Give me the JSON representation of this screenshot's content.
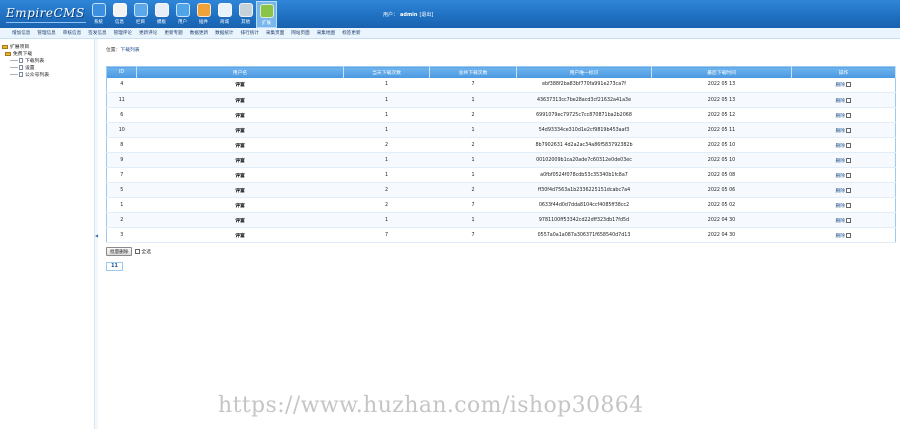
{
  "brand": {
    "logo_text": "EmpireCMS"
  },
  "nav": {
    "items": [
      {
        "label": "系统",
        "icon": "system-icon",
        "color": "#3a8fe0"
      },
      {
        "label": "信息",
        "icon": "info-icon",
        "color": "#f3f3f3"
      },
      {
        "label": "栏目",
        "icon": "column-icon",
        "color": "#5aa7ea"
      },
      {
        "label": "模板",
        "icon": "template-icon",
        "color": "#e8eef5"
      },
      {
        "label": "用户",
        "icon": "user-icon",
        "color": "#4da4e8"
      },
      {
        "label": "插件",
        "icon": "plugin-icon",
        "color": "#f0a23a"
      },
      {
        "label": "商城",
        "icon": "shop-icon",
        "color": "#e8f2fa"
      },
      {
        "label": "其他",
        "icon": "other-icon",
        "color": "#c7d1da"
      },
      {
        "label": "扩展",
        "icon": "extend-icon",
        "color": "#8bc34a",
        "active": true
      }
    ]
  },
  "user": {
    "prefix": "用户：",
    "name": "admin",
    "logout": "[退出]"
  },
  "subnav": {
    "items": [
      "增加信息",
      "管理信息",
      "审核信息",
      "签发信息",
      "管理评论",
      "更新评论",
      "更新专题",
      "数据更新",
      "数据统计",
      "排行统计",
      "采集页面",
      "网站页面",
      "采集地图",
      "标签更新"
    ]
  },
  "tree": {
    "root": "扩展项目",
    "group": "免费下载",
    "children": [
      "下载列表",
      "设置",
      "公众号列表"
    ]
  },
  "breadcrumb": {
    "prefix": "位置：",
    "link": "下载列表"
  },
  "table": {
    "headers": [
      "ID",
      "用户名",
      "当天下载次数",
      "总共下载次数",
      "用户唯一标识",
      "最后下载时间",
      "操作"
    ],
    "rows": [
      {
        "id": "4",
        "username": "评富",
        "today": "1",
        "total": "7",
        "uid": "ebf388f2ba83bf770fa991e273ca7f",
        "last": "2022 05 13",
        "op": "删除"
      },
      {
        "id": "11",
        "username": "评富",
        "today": "1",
        "total": "1",
        "uid": "43637313cc7be28acd3cf21632a41a3e",
        "last": "2022 05 13",
        "op": "删除"
      },
      {
        "id": "6",
        "username": "评富",
        "today": "1",
        "total": "2",
        "uid": "6991079ec79725c7cc870871ba2b2068",
        "last": "2022 05 12",
        "op": "删除"
      },
      {
        "id": "10",
        "username": "评富",
        "today": "1",
        "total": "1",
        "uid": "54d93334ce310d1e2cf9819b453aaf3",
        "last": "2022 05 11",
        "op": "删除"
      },
      {
        "id": "8",
        "username": "评富",
        "today": "2",
        "total": "2",
        "uid": "8b7902631 4d2a2ac34a86f583792382b",
        "last": "2022 05 10",
        "op": "删除"
      },
      {
        "id": "9",
        "username": "评富",
        "today": "1",
        "total": "1",
        "uid": "00102009b1ca20ade7c60312e0de03ec",
        "last": "2022 05 10",
        "op": "删除"
      },
      {
        "id": "7",
        "username": "评富",
        "today": "1",
        "total": "1",
        "uid": "a0fbf0524f078cdb53c35340b1fc8a7",
        "last": "2022 05 08",
        "op": "删除"
      },
      {
        "id": "5",
        "username": "评富",
        "today": "2",
        "total": "2",
        "uid": "ff30f4d7563a1b2336225151dcabc7a4",
        "last": "2022 05 06",
        "op": "删除"
      },
      {
        "id": "1",
        "username": "评富",
        "today": "2",
        "total": "7",
        "uid": "0633f44d0d7dda8104ccf4085ff38cc2",
        "last": "2022 05 02",
        "op": "删除"
      },
      {
        "id": "2",
        "username": "评富",
        "today": "1",
        "total": "1",
        "uid": "9781100ff53342cd22dff323db17fd5d",
        "last": "2022 04 30",
        "op": "删除"
      },
      {
        "id": "3",
        "username": "评富",
        "today": "7",
        "total": "7",
        "uid": "0557a0a1a087a306371f658540d7d13",
        "last": "2022 04 30",
        "op": "删除"
      }
    ]
  },
  "actions": {
    "batch_delete": "批量删除",
    "select_all": "全选"
  },
  "pager": {
    "current": "11"
  },
  "watermark": "https://www.huzhan.com/ishop30864",
  "colors": {
    "topbar": "#1f6fc0",
    "header": "#4a98e0",
    "accent": "#9ccaf0"
  }
}
